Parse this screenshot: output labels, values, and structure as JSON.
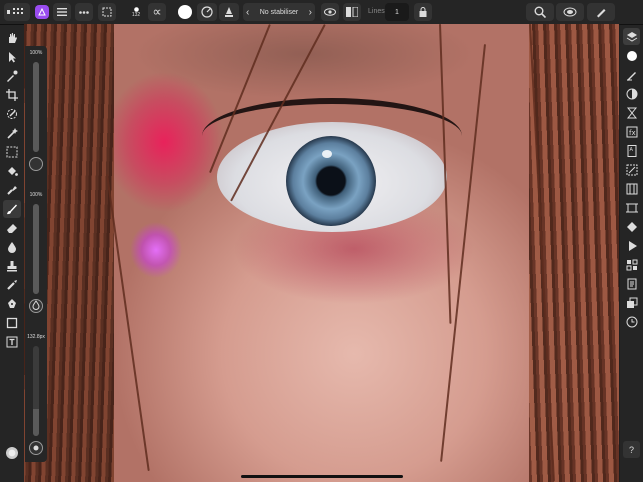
{
  "toolbar": {
    "apps_icon": "apps-grid-icon",
    "persona_icon": "photo-persona-icon",
    "menu_icon": "hamburger-menu-icon",
    "more_icon": "more-dots-icon",
    "selection_icon": "marquee-selection-icon",
    "brush_size_value": "132",
    "alpha_symbol": "∝",
    "color_swatch": "#ffffff",
    "stabiliser_label": "No stabiliser",
    "prev_arrow": "‹",
    "next_arrow": "›",
    "lines_label": "Lines",
    "lines_value": "1",
    "accent": "#9a4cf0"
  },
  "sliders": {
    "opacity_label": "100%",
    "opacity_level": 1.0,
    "flow_label": "100%",
    "flow_level": 1.0,
    "width_label": "132.8px",
    "width_level": 0.3
  },
  "left_tools": [
    "view-hand-icon",
    "move-tool-icon",
    "color-picker-icon",
    "crop-tool-icon",
    "selection-brush-icon",
    "flood-select-icon",
    "marquee-icon",
    "fill-tool-icon",
    "gradient-tool-icon",
    "paint-brush-icon",
    "erase-brush-icon",
    "dodge-burn-icon",
    "clone-stamp-icon",
    "healing-brush-icon",
    "pen-tool-icon",
    "shape-tool-icon",
    "text-tool-icon"
  ],
  "right_tools": [
    "layers-icon",
    "color-studio-icon",
    "brushes-icon",
    "adjustments-icon",
    "fx-filter-icon",
    "live-filter-icon",
    "stock-icon",
    "transform-icon",
    "navigator-icon",
    "history-icon",
    "channels-icon",
    "swatches-icon",
    "glyph-browser-icon",
    "snapshots-icon",
    "clock-history-icon"
  ],
  "help_label": "?"
}
